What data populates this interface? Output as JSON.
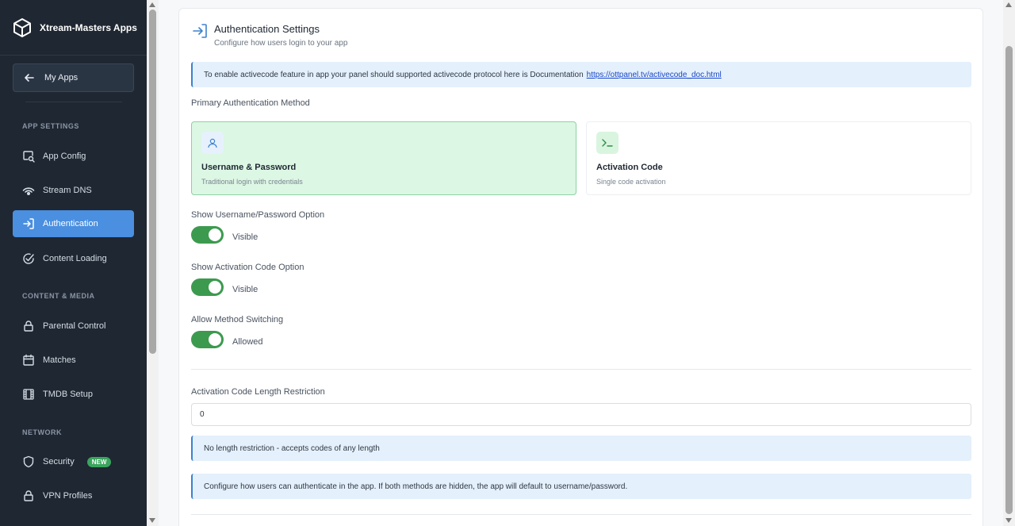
{
  "brand": {
    "name": "Xtream-Masters Apps",
    "icon": "cube-icon"
  },
  "sidebar": {
    "back_label": "My Apps",
    "sections": [
      {
        "label": "APP SETTINGS"
      },
      {
        "label": "CONTENT & MEDIA"
      },
      {
        "label": "NETWORK"
      }
    ],
    "items": [
      {
        "label": "App Config",
        "icon": "search-screen-icon"
      },
      {
        "label": "Stream DNS",
        "icon": "signal-icon"
      },
      {
        "label": "Authentication",
        "icon": "login-icon",
        "active": true
      },
      {
        "label": "Content Loading",
        "icon": "check-circle-icon"
      },
      {
        "label": "Parental Control",
        "icon": "lock-icon"
      },
      {
        "label": "Matches",
        "icon": "calendar-icon"
      },
      {
        "label": "TMDB Setup",
        "icon": "film-icon"
      },
      {
        "label": "Security",
        "icon": "shield-icon",
        "badge": "NEW"
      },
      {
        "label": "VPN Profiles",
        "icon": "lock-icon"
      }
    ],
    "active_color": "#4a8fe0"
  },
  "main": {
    "title": "Authentication Settings",
    "subtitle": "Configure how users login to your app",
    "info_activecode": {
      "text": "To enable activecode feature in app your panel should supported activecode protocol here is Documentation",
      "link": "https://ottpanel.tv/activecode_doc.html"
    },
    "primary_label": "Primary Authentication Method",
    "methods": [
      {
        "title": "Username & Password",
        "desc": "Traditional login with credentials",
        "icon": "user-icon",
        "selected": true
      },
      {
        "title": "Activation Code",
        "desc": "Single code activation",
        "icon": "terminal-icon",
        "selected": false
      }
    ],
    "toggles": [
      {
        "label": "Show Username/Password Option",
        "state": "Visible",
        "on": true
      },
      {
        "label": "Show Activation Code Option",
        "state": "Visible",
        "on": true
      },
      {
        "label": "Allow Method Switching",
        "state": "Allowed",
        "on": true
      }
    ],
    "code_length": {
      "label": "Activation Code Length Restriction",
      "value": "0",
      "hint": "No length restriction - accepts codes of any length"
    },
    "footer_info": "Configure how users can authenticate in the app. If both methods are hidden, the app will default to username/password.",
    "accent_color": "#3c9a4f"
  }
}
